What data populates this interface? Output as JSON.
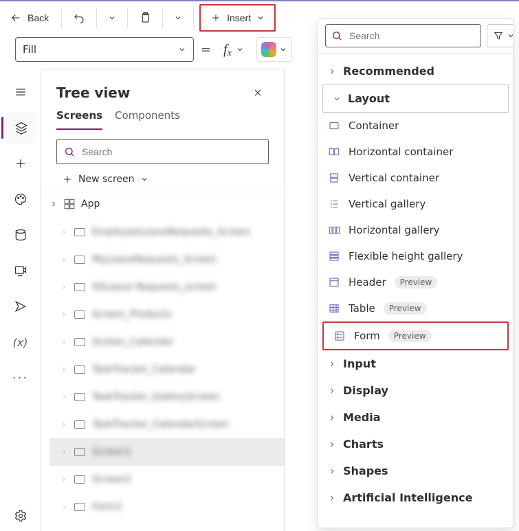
{
  "topbar": {
    "back_label": "Back",
    "insert_label": "Insert"
  },
  "formula": {
    "property": "Fill",
    "equals": "="
  },
  "tree": {
    "title": "Tree view",
    "tabs": {
      "screens": "Screens",
      "components": "Components"
    },
    "search_placeholder": "Search",
    "new_screen_label": "New screen",
    "root_label": "App",
    "items": [
      {
        "label": "EmployeeLeaveRequests_Screen"
      },
      {
        "label": "MyLeaveRequests_Screen"
      },
      {
        "label": "AllLeave Requests_screen"
      },
      {
        "label": "Screen_Products"
      },
      {
        "label": "Screen_Calendar"
      },
      {
        "label": "TaskTracker_Calendar"
      },
      {
        "label": "TaskTracker_GalleryScreen"
      },
      {
        "label": "TaskTracker_CalendarScreen"
      },
      {
        "label": "Screen1"
      },
      {
        "label": "Screen2"
      },
      {
        "label": "Form1"
      }
    ]
  },
  "insert": {
    "search_placeholder": "Search",
    "categories": {
      "recommended": "Recommended",
      "layout": "Layout",
      "input": "Input",
      "display": "Display",
      "media": "Media",
      "charts": "Charts",
      "shapes": "Shapes",
      "ai": "Artificial Intelligence"
    },
    "layout_items": {
      "container": "Container",
      "hcontainer": "Horizontal container",
      "vcontainer": "Vertical container",
      "vgallery": "Vertical gallery",
      "hgallery": "Horizontal gallery",
      "flexgallery": "Flexible height gallery",
      "header": "Header",
      "table": "Table",
      "form": "Form"
    },
    "preview_badge": "Preview"
  }
}
